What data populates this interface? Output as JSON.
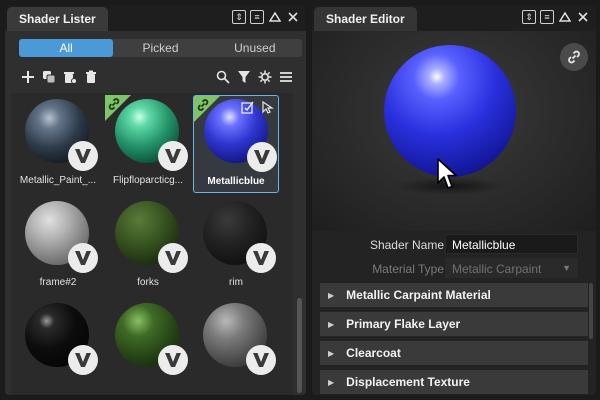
{
  "lister": {
    "title": "Shader Lister",
    "tabs": [
      {
        "label": "All",
        "active": true
      },
      {
        "label": "Picked",
        "active": false
      },
      {
        "label": "Unused",
        "active": false
      }
    ],
    "toolbar_icons": [
      "add-icon",
      "duplicate-icon",
      "clean-icon",
      "delete-icon",
      "search-icon",
      "filter-icon",
      "settings-icon",
      "menu-icon"
    ],
    "shaders": [
      {
        "name": "Metallic_Paint_...",
        "swatch": "metallic",
        "linked": false,
        "selected": false
      },
      {
        "name": "Flipfloparcticg...",
        "swatch": "flip",
        "linked": true,
        "selected": false
      },
      {
        "name": "Metallicblue",
        "swatch": "blue",
        "linked": true,
        "selected": true
      },
      {
        "name": "frame#2",
        "swatch": "frame",
        "linked": false,
        "selected": false
      },
      {
        "name": "forks",
        "swatch": "forks",
        "linked": false,
        "selected": false
      },
      {
        "name": "rim",
        "swatch": "rim",
        "linked": false,
        "selected": false
      },
      {
        "name": "",
        "swatch": "black",
        "linked": false,
        "selected": false
      },
      {
        "name": "",
        "swatch": "green2",
        "linked": false,
        "selected": false
      },
      {
        "name": "",
        "swatch": "grey2",
        "linked": false,
        "selected": false
      }
    ]
  },
  "editor": {
    "title": "Shader Editor",
    "shader_name_label": "Shader Name",
    "shader_name_value": "Metallicblue",
    "material_type_label": "Material Type",
    "material_type_value": "Metallic Carpaint",
    "sections": [
      "Metallic Carpaint Material",
      "Primary Flake Layer",
      "Clearcoat",
      "Displacement Texture"
    ]
  },
  "colors": {
    "accent": "#4a9ad8",
    "link_badge": "#7fc36a",
    "selection_border": "#6fb3e6"
  }
}
